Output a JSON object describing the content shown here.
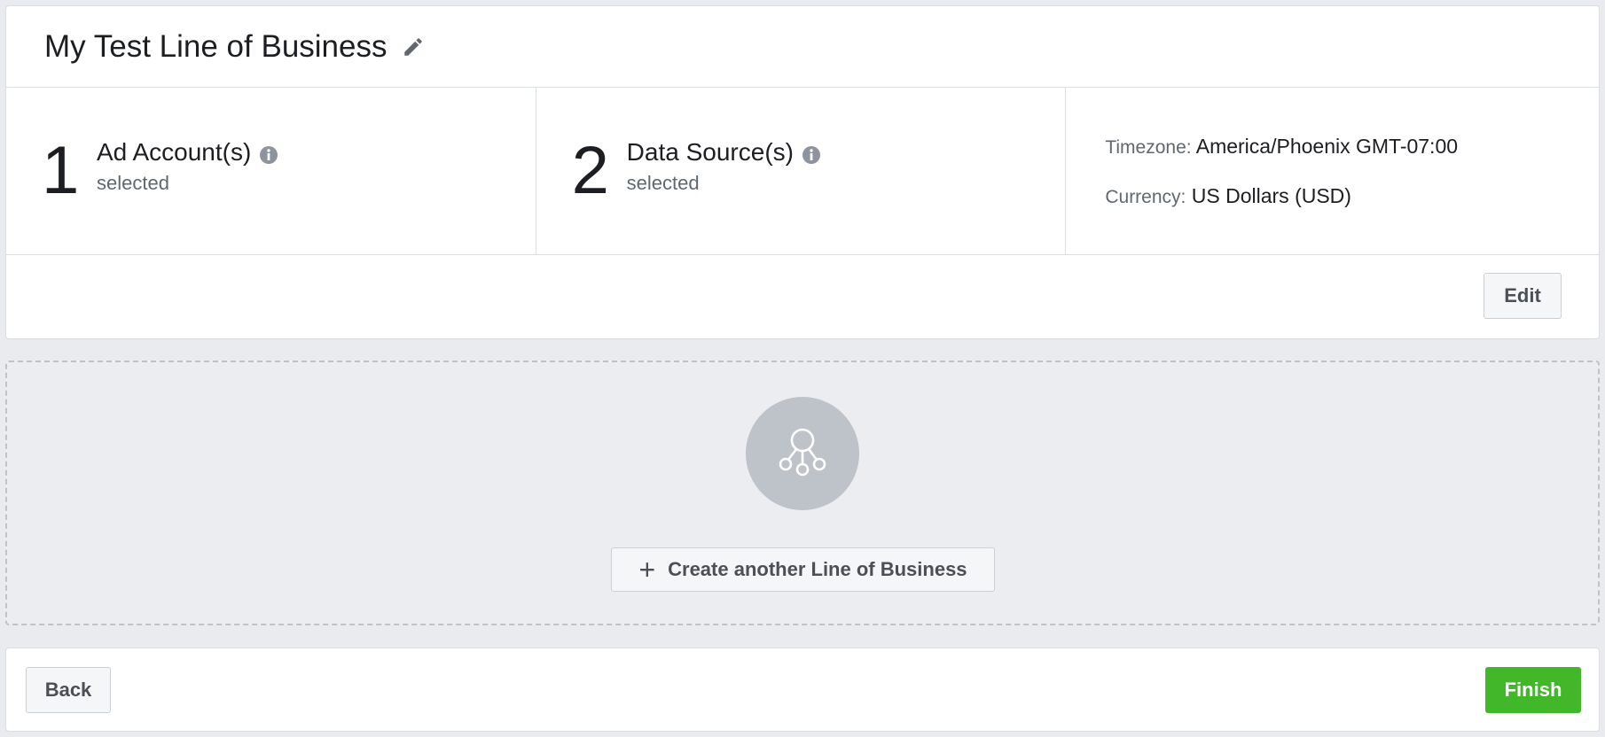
{
  "lob": {
    "title": "My Test Line of Business",
    "ad_accounts": {
      "count": "1",
      "label": "Ad Account(s)",
      "sub": "selected"
    },
    "data_sources": {
      "count": "2",
      "label": "Data Source(s)",
      "sub": "selected"
    },
    "timezone": {
      "key": "Timezone:",
      "value": "America/Phoenix GMT-07:00"
    },
    "currency": {
      "key": "Currency:",
      "value": "US Dollars (USD)"
    },
    "edit_label": "Edit"
  },
  "create": {
    "icon": "line-of-business-icon",
    "plus": "+",
    "label": "Create another Line of Business"
  },
  "footer": {
    "back_label": "Back",
    "finish_label": "Finish"
  },
  "colors": {
    "finish": "#42b72a",
    "background": "#e9ebee",
    "border": "#dadde1"
  }
}
